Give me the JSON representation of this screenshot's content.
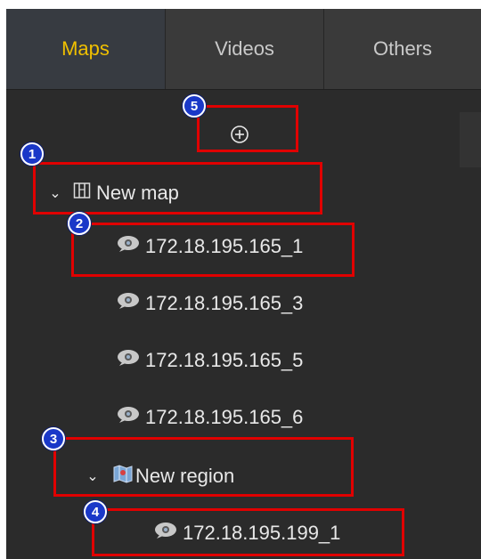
{
  "tabs": [
    {
      "label": "Maps",
      "active": true
    },
    {
      "label": "Videos",
      "active": false
    },
    {
      "label": "Others",
      "active": false
    }
  ],
  "add_icon": "plus-circle-icon",
  "tree": {
    "map": {
      "label": "New map",
      "icon": "map-icon",
      "expanded": true
    },
    "map_devices": [
      {
        "label": "172.18.195.165_1",
        "icon": "camera-icon"
      },
      {
        "label": "172.18.195.165_3",
        "icon": "camera-icon"
      },
      {
        "label": "172.18.195.165_5",
        "icon": "camera-icon"
      },
      {
        "label": "172.18.195.165_6",
        "icon": "camera-icon"
      }
    ],
    "region": {
      "label": "New region",
      "icon": "region-map-icon",
      "expanded": true
    },
    "region_devices": [
      {
        "label": "172.18.195.199_1",
        "icon": "camera-icon"
      }
    ]
  },
  "callouts": [
    "1",
    "2",
    "3",
    "4",
    "5"
  ],
  "colors": {
    "panel_bg": "#2b2b2b",
    "active_tab_text": "#f0c000",
    "highlight": "#e00000",
    "badge": "#1a38c8"
  }
}
